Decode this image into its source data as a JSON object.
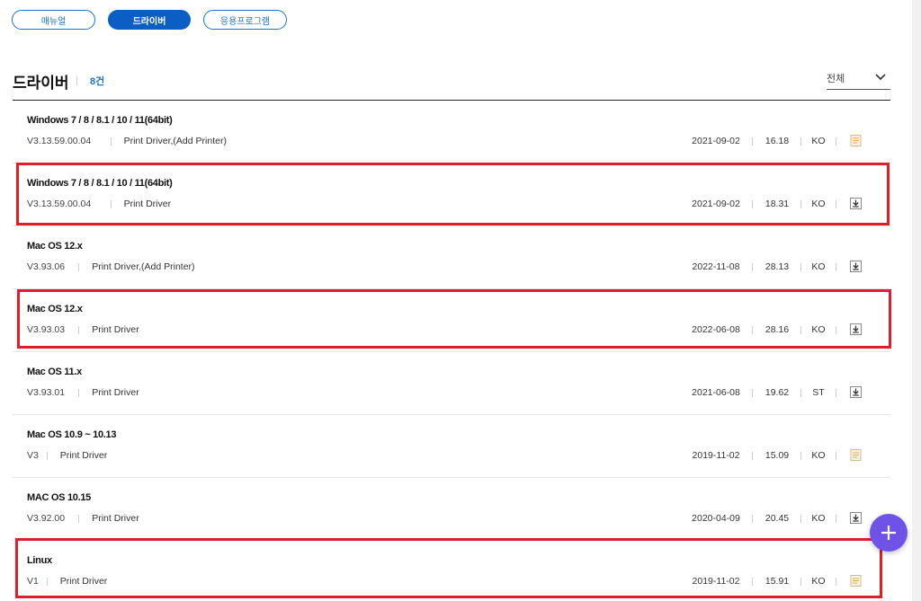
{
  "tabs": [
    {
      "label": "매뉴얼",
      "active": false
    },
    {
      "label": "드라이버",
      "active": true
    },
    {
      "label": "응용프로그램",
      "active": false
    }
  ],
  "header": {
    "title": "드라이버",
    "count": "8건",
    "filter_label": "전체"
  },
  "drivers": [
    {
      "os": "Windows 7 / 8 / 8.1 / 10 / 11(64bit)",
      "version": "V3.13.59.00.04",
      "description": "Print Driver,(Add Printer)",
      "date": "2021-09-02",
      "size": "16.18",
      "lang": "KO",
      "icon": "document-icon"
    },
    {
      "os": "Windows 7 / 8 / 8.1 / 10 / 11(64bit)",
      "version": "V3.13.59.00.04",
      "description": "Print Driver",
      "date": "2021-09-02",
      "size": "18.31",
      "lang": "KO",
      "icon": "download-icon"
    },
    {
      "os": "Mac OS 12.x",
      "version": "V3.93.06",
      "description": "Print Driver,(Add Printer)",
      "date": "2022-11-08",
      "size": "28.13",
      "lang": "KO",
      "icon": "download-icon"
    },
    {
      "os": "Mac OS 12.x",
      "version": "V3.93.03",
      "description": "Print Driver",
      "date": "2022-06-08",
      "size": "28.16",
      "lang": "KO",
      "icon": "download-icon"
    },
    {
      "os": "Mac OS 11.x",
      "version": "V3.93.01",
      "description": "Print Driver",
      "date": "2021-06-08",
      "size": "19.62",
      "lang": "ST",
      "icon": "download-icon"
    },
    {
      "os": "Mac OS 10.9 ~ 10.13",
      "version": "V3",
      "description": "Print Driver",
      "date": "2019-11-02",
      "size": "15.09",
      "lang": "KO",
      "icon": "document-icon"
    },
    {
      "os": "MAC OS 10.15",
      "version": "V3.92.00",
      "description": "Print Driver",
      "date": "2020-04-09",
      "size": "20.45",
      "lang": "KO",
      "icon": "download-icon"
    },
    {
      "os": "Linux",
      "version": "V1",
      "description": "Print Driver",
      "date": "2019-11-02",
      "size": "15.91",
      "lang": "KO",
      "icon": "document-icon"
    }
  ],
  "colors": {
    "accent": "#0b5fc4",
    "highlight": "#e01e2b",
    "fab": "#6f52e8"
  }
}
